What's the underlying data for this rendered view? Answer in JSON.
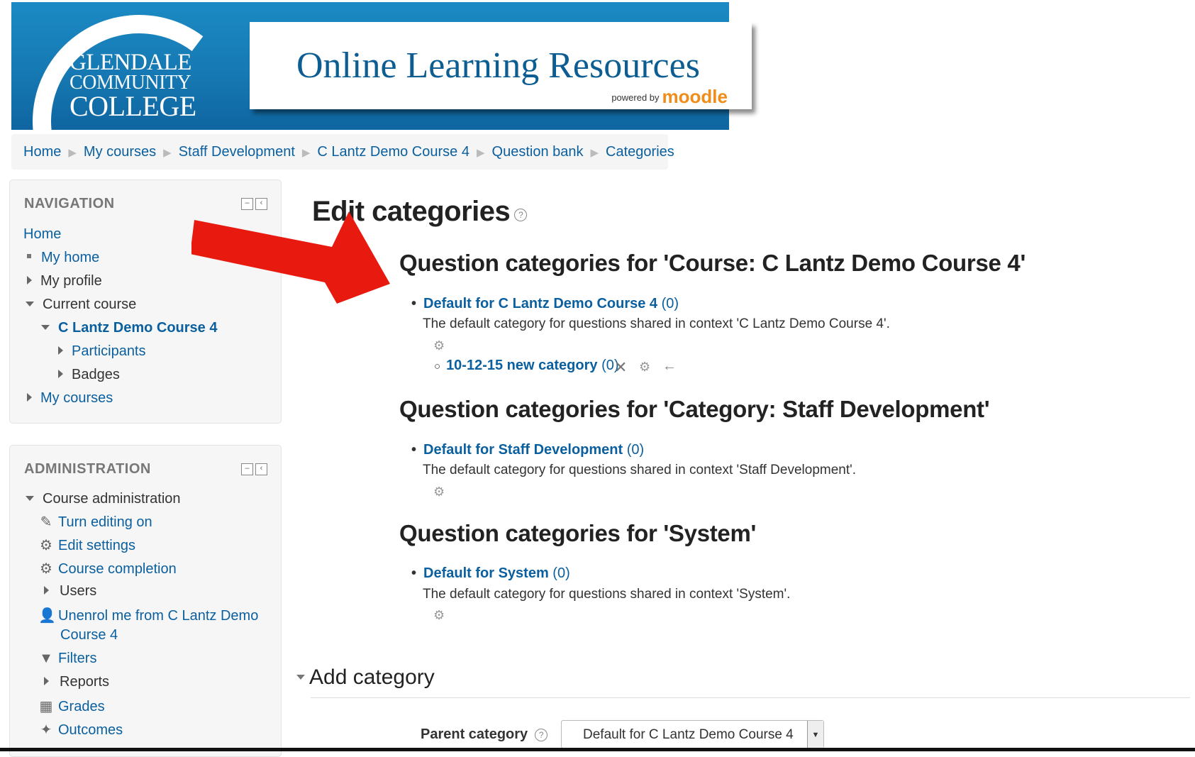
{
  "banner": {
    "college_line1": "GLENDALE",
    "college_line2": "COMMUNITY",
    "college_line3": "COLLEGE",
    "title": "Online Learning Resources",
    "powered_by": "powered by",
    "moodle": "moodle"
  },
  "breadcrumb": [
    "Home",
    "My courses",
    "Staff Development",
    "C Lantz Demo Course 4",
    "Question bank",
    "Categories"
  ],
  "navigation": {
    "heading": "NAVIGATION",
    "home": "Home",
    "my_home": "My home",
    "my_profile": "My profile",
    "current_course": "Current course",
    "course_name": "C Lantz Demo Course 4",
    "participants": "Participants",
    "badges": "Badges",
    "my_courses": "My courses"
  },
  "administration": {
    "heading": "ADMINISTRATION",
    "course_admin": "Course administration",
    "turn_editing": "Turn editing on",
    "edit_settings": "Edit settings",
    "course_completion": "Course completion",
    "users": "Users",
    "unenrol_line1": "Unenrol me from C Lantz Demo",
    "unenrol_line2": "Course 4",
    "filters": "Filters",
    "reports": "Reports",
    "grades": "Grades",
    "outcomes": "Outcomes"
  },
  "main": {
    "title": "Edit categories",
    "sections": [
      {
        "heading": "Question categories for 'Course: C Lantz Demo Course 4'",
        "category": "Default for C Lantz Demo Course 4",
        "count": "(0)",
        "desc": "The default category for questions shared in context 'C Lantz Demo Course 4'.",
        "sub_category": "10-12-15 new category",
        "sub_count": "(0)"
      },
      {
        "heading": "Question categories for 'Category: Staff Development'",
        "category": "Default for Staff Development",
        "count": "(0)",
        "desc": "The default category for questions shared in context 'Staff Development'."
      },
      {
        "heading": "Question categories for 'System'",
        "category": "Default for System",
        "count": "(0)",
        "desc": "The default category for questions shared in context 'System'."
      }
    ],
    "add_category": "Add category",
    "parent_label": "Parent category",
    "parent_value": "Default for C Lantz Demo Course 4"
  },
  "colors": {
    "link": "#0a5f9e",
    "arrow": "#e8190f",
    "banner": "#1679b3"
  }
}
